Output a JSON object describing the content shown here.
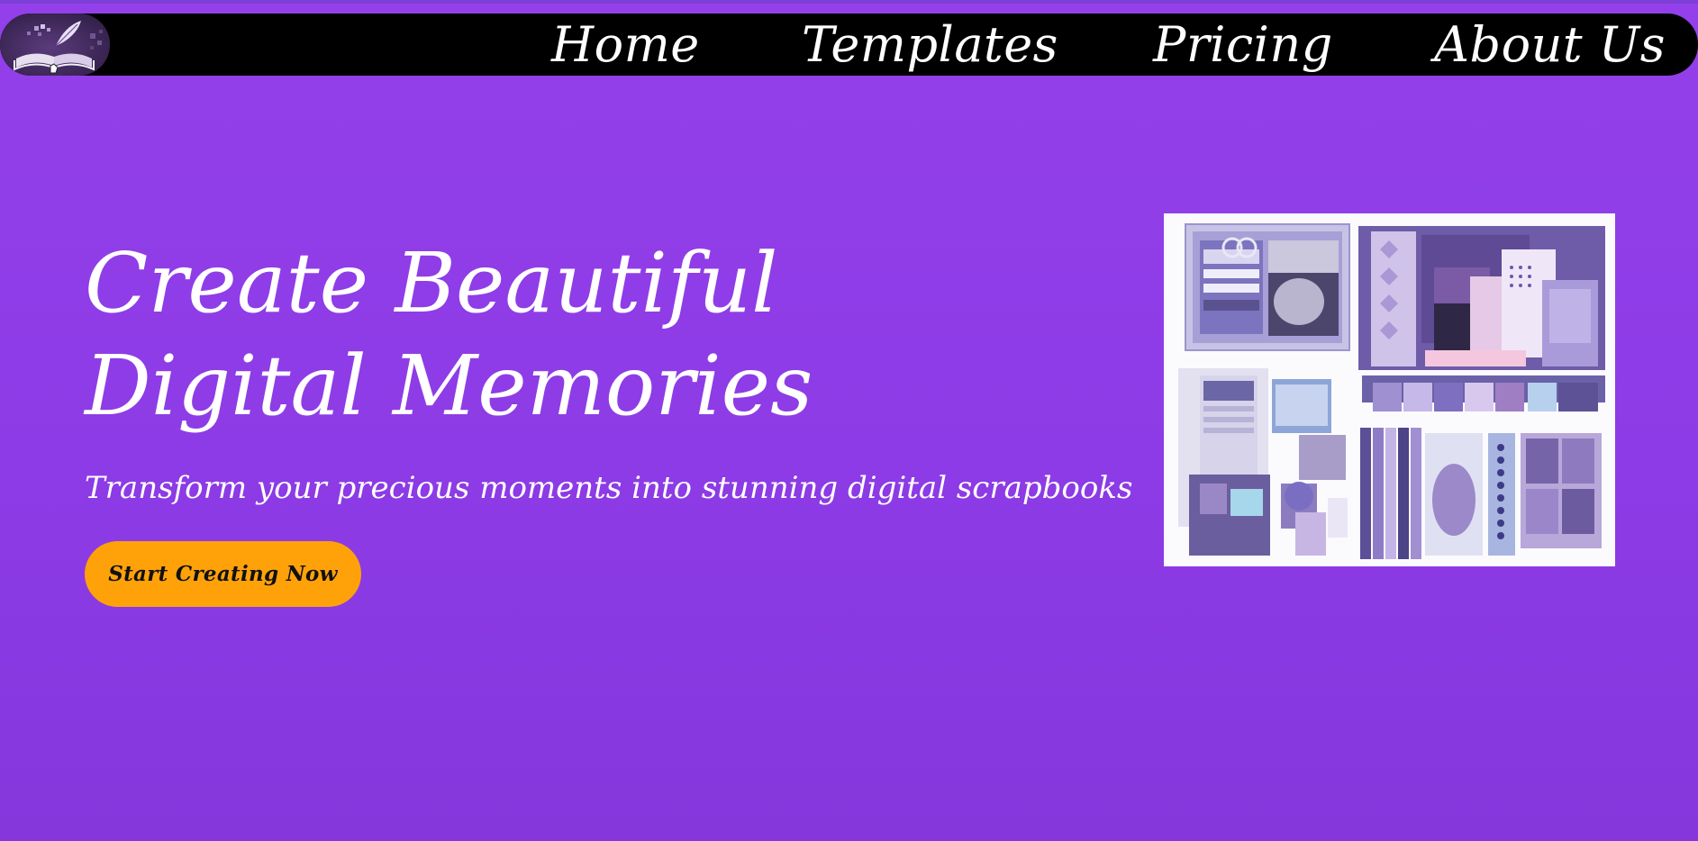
{
  "nav": {
    "logo_icon": "open-book-quill-icon",
    "links": [
      {
        "label": "Home"
      },
      {
        "label": "Templates"
      },
      {
        "label": "Pricing"
      },
      {
        "label": "About Us"
      }
    ]
  },
  "hero": {
    "title": "Create Beautiful Digital Memories",
    "subtitle": "Transform your precious moments into stunning digital scrapbooks",
    "cta_label": "Start Creating Now",
    "image_label": "scrapbook-kit-collage"
  },
  "colors": {
    "background": "#9340ea",
    "navbar": "#000000",
    "cta": "#ffa20a",
    "text": "#ffffff"
  }
}
